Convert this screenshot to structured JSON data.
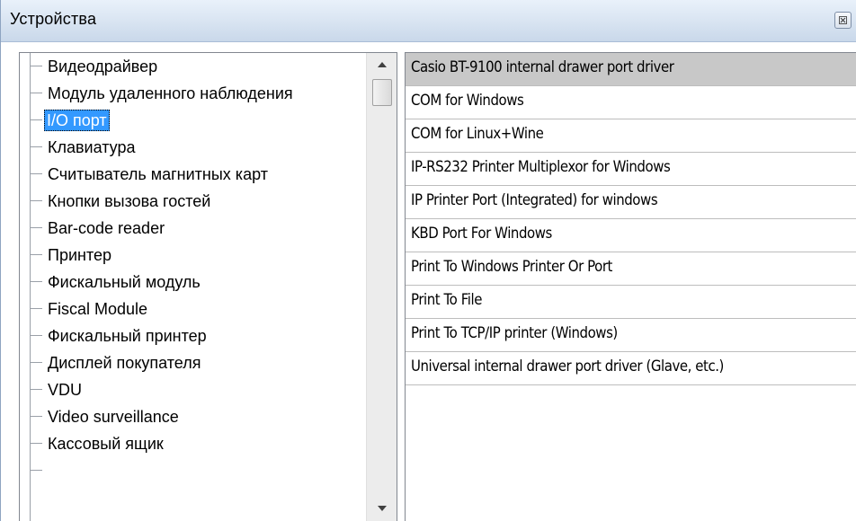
{
  "window": {
    "title": "Устройства"
  },
  "tree": {
    "selected_index": 2,
    "items": [
      {
        "label": "Видеодрайвер"
      },
      {
        "label": "Модуль удаленного наблюдения"
      },
      {
        "label": "I/O порт"
      },
      {
        "label": "Клавиатура"
      },
      {
        "label": "Считыватель магнитных карт"
      },
      {
        "label": "Кнопки вызова гостей"
      },
      {
        "label": "Bar-code reader"
      },
      {
        "label": "Принтер"
      },
      {
        "label": "Фискальный модуль"
      },
      {
        "label": "Fiscal Module"
      },
      {
        "label": "Фискальный принтер"
      },
      {
        "label": "Дисплей покупателя"
      },
      {
        "label": "VDU"
      },
      {
        "label": "Video surveillance"
      },
      {
        "label": "Кассовый ящик"
      }
    ]
  },
  "drivers": {
    "selected_index": 0,
    "items": [
      {
        "label": "Casio BT-9100 internal drawer port driver"
      },
      {
        "label": "COM for Windows"
      },
      {
        "label": "COM for Linux+Wine"
      },
      {
        "label": "IP-RS232 Printer Multiplexor for Windows"
      },
      {
        "label": "IP Printer Port (Integrated) for windows"
      },
      {
        "label": "KBD Port For Windows"
      },
      {
        "label": "Print To Windows Printer Or Port"
      },
      {
        "label": "Print To File"
      },
      {
        "label": "Print To TCP/IP printer (Windows)"
      },
      {
        "label": "Universal internal drawer port driver (Glave, etc.)"
      }
    ]
  }
}
